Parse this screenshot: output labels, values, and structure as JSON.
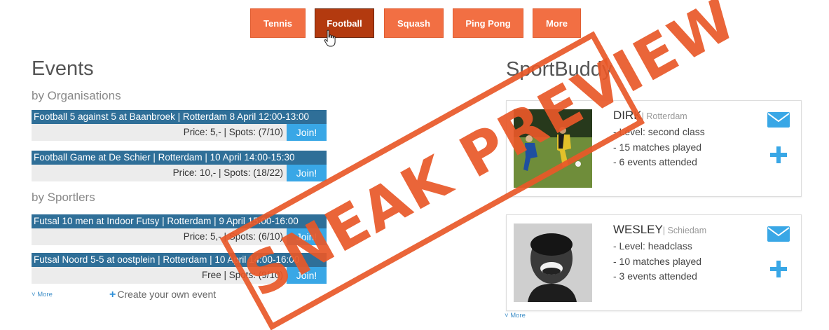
{
  "nav": {
    "tabs": [
      {
        "label": "Tennis",
        "active": false
      },
      {
        "label": "Football",
        "active": true
      },
      {
        "label": "Squash",
        "active": false
      },
      {
        "label": "Ping Pong",
        "active": false
      },
      {
        "label": "More",
        "active": false
      }
    ]
  },
  "events": {
    "heading": "Events",
    "organisations": {
      "subheading": "by Organisations",
      "items": [
        {
          "title": "Football 5 against 5 at Baanbroek | Rotterdam 8 April 12:00-13:00",
          "info": "Price: 5,- | Spots: (7/10)",
          "join_label": "Join!"
        },
        {
          "title": "Football Game at De Schier | Rotterdam | 10 April 14:00-15:30",
          "info": "Price: 10,- | Spots: (18/22)",
          "join_label": "Join!"
        }
      ]
    },
    "sportlers": {
      "subheading": "by Sportlers",
      "items": [
        {
          "title": "Futsal 10 men at Indoor Futsy | Rotterdam | 9 April 15:00-16:00",
          "info": "Price: 5,- | Spots: (6/10)",
          "join_label": "Join!"
        },
        {
          "title": "Futsal Noord 5-5 at oostplein | Rotterdam | 10 April 14:00-16:00",
          "info": "Free | Spots: (9/10)",
          "join_label": "Join!"
        }
      ]
    },
    "more_label": "More",
    "create_label": "Create your own event"
  },
  "sportbuddy": {
    "heading": "SportBuddy",
    "buddies": [
      {
        "name": "DIRK",
        "city": "| Rotterdam",
        "level": "- Level: second class",
        "matches": "- 15 matches played",
        "events": "- 6 events attended"
      },
      {
        "name": "WESLEY",
        "city": "| Schiedam",
        "level": "- Level: headclass",
        "matches": "- 10 matches played",
        "events": "- 3 events attended"
      }
    ],
    "more_label": "More"
  },
  "stamp": {
    "text": "SNEAK PREVIEW",
    "color": "#e85828"
  },
  "colors": {
    "tab": "#f26f43",
    "tab_active": "#b33a0f",
    "event_header": "#2f6f98",
    "join": "#39a7e6"
  },
  "icons": {
    "mail": "mail-icon",
    "add": "plus-icon",
    "cursor": "hand-cursor-icon",
    "more": "chevron-down-icon"
  }
}
